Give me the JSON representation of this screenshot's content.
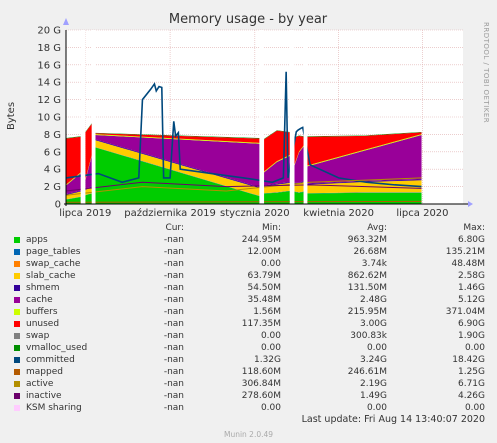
{
  "chart_data": {
    "type": "area",
    "title": "Memory usage - by year",
    "ylabel": "Bytes",
    "side_label": "RRDTOOL / TOBI OETIKER",
    "ylim": [
      0,
      20
    ],
    "y_ticks": [
      "0",
      "2 G",
      "4 G",
      "6 G",
      "8 G",
      "10 G",
      "12 G",
      "14 G",
      "16 G",
      "18 G",
      "20 G"
    ],
    "x_ticks": [
      "lipca 2019",
      "października 2019",
      "stycznia 2020",
      "kwietnia 2020",
      "lipca 2020"
    ],
    "x_range": [
      "2019-06-10",
      "2020-08-14"
    ],
    "gaps": [
      [
        "2019-06-26",
        "2019-07-01"
      ],
      [
        "2019-07-08",
        "2019-07-12"
      ],
      [
        "2020-01-06",
        "2020-01-11"
      ],
      [
        "2020-02-08",
        "2020-02-13"
      ],
      [
        "2020-02-23",
        "2020-02-27"
      ]
    ],
    "series": [
      {
        "name": "apps",
        "color": "#00cc00",
        "values": [
          [
            0.5,
            0.8
          ],
          [
            1.0,
            1.2
          ],
          [
            6.5,
            0.9
          ],
          [
            1.2,
            1.3,
            1.5
          ],
          [
            1.4,
            1.3,
            1.4
          ],
          [
            1.2,
            1.3,
            1.3
          ]
        ]
      },
      {
        "name": "page_tables",
        "color": "#0066b3",
        "values": [
          [
            0.03,
            0.03
          ],
          [
            0.03,
            0.03
          ],
          [
            0.03,
            0.03
          ],
          [
            0.03,
            0.03,
            0.03
          ],
          [
            0.03,
            0.03,
            0.03
          ],
          [
            0.03,
            0.03,
            0.03
          ]
        ]
      },
      {
        "name": "swap_cache",
        "color": "#ff8000",
        "values": [
          [
            0,
            0
          ],
          [
            0,
            0
          ],
          [
            0,
            0
          ],
          [
            0,
            0,
            0
          ],
          [
            0,
            0,
            0
          ],
          [
            0,
            0,
            0
          ]
        ]
      },
      {
        "name": "slab_cache",
        "color": "#ffcc00",
        "values": [
          [
            0.5,
            0.6
          ],
          [
            0.6,
            0.7
          ],
          [
            0.8,
            0.9
          ],
          [
            0.8,
            0.9,
            0.9
          ],
          [
            0.9,
            1.0,
            1.1
          ],
          [
            1.0,
            1.2,
            1.4
          ]
        ]
      },
      {
        "name": "shmem",
        "color": "#330099",
        "values": [
          [
            0.1,
            0.1
          ],
          [
            0.1,
            0.1
          ],
          [
            0.1,
            0.1
          ],
          [
            0.1,
            0.1,
            0.1
          ],
          [
            0.1,
            0.1,
            0.1
          ],
          [
            0.1,
            0.1,
            0.1
          ]
        ]
      },
      {
        "name": "cache",
        "color": "#990099",
        "values": [
          [
            1.0,
            2.0
          ],
          [
            1.0,
            3.5
          ],
          [
            0.5,
            5.0
          ],
          [
            1.5,
            2.5,
            3.0
          ],
          [
            2.0,
            3.5,
            4.0
          ],
          [
            2.0,
            3.5,
            5.1
          ]
        ]
      },
      {
        "name": "buffers",
        "color": "#ccff00",
        "values": [
          [
            0.1,
            0.1
          ],
          [
            0.1,
            0.1
          ],
          [
            0.1,
            0.1
          ],
          [
            0.1,
            0.1,
            0.1
          ],
          [
            0.1,
            0.1,
            0.1
          ],
          [
            0.1,
            0.1,
            0.1
          ]
        ]
      },
      {
        "name": "unused",
        "color": "#ff0000",
        "values": [
          [
            5.3,
            4.1
          ],
          [
            5.4,
            3.6
          ],
          [
            0.1,
            0.5
          ],
          [
            3.7,
            3.5,
            2.6
          ],
          [
            3.1,
            1.8,
            1.0
          ],
          [
            3.3,
            1.6,
            0.2
          ]
        ]
      },
      {
        "name": "swap",
        "color": "#808080",
        "values": [
          [
            0,
            0
          ],
          [
            0,
            0
          ],
          [
            0,
            0
          ],
          [
            0,
            0,
            0
          ],
          [
            0,
            0,
            0
          ],
          [
            0,
            0,
            0
          ]
        ]
      },
      {
        "name": "vmalloc_used",
        "color": "#008f00",
        "values": [
          [
            0.05,
            0.05
          ],
          [
            0.05,
            0.05
          ],
          [
            0.05,
            0.05
          ],
          [
            0.05,
            0.05,
            0.05
          ],
          [
            0.05,
            0.05,
            0.05
          ],
          [
            0.05,
            0.05,
            0.05
          ]
        ]
      },
      {
        "name": "committed",
        "color": "#00487d",
        "line": true,
        "points": [
          [
            "2019-06-10",
            3.0
          ],
          [
            "2019-07-15",
            3.5
          ],
          [
            "2019-08-10",
            2.5
          ],
          [
            "2019-08-28",
            3.0
          ],
          [
            "2019-09-01",
            12.0
          ],
          [
            "2019-09-10",
            13.2
          ],
          [
            "2019-09-14",
            13.8
          ],
          [
            "2019-09-16",
            13.0
          ],
          [
            "2019-09-19",
            13.5
          ],
          [
            "2019-09-22",
            13.4
          ],
          [
            "2019-09-24",
            3.0
          ],
          [
            "2019-10-01",
            3.0
          ],
          [
            "2019-10-05",
            9.5
          ],
          [
            "2019-10-07",
            7.8
          ],
          [
            "2019-10-10",
            8.2
          ],
          [
            "2019-10-12",
            4.0
          ],
          [
            "2019-11-15",
            3.5
          ],
          [
            "2019-12-20",
            3.0
          ],
          [
            "2020-01-20",
            2.5
          ],
          [
            "2020-02-01",
            3.0
          ],
          [
            "2020-02-04",
            15.2
          ],
          [
            "2020-02-06",
            3.0
          ],
          [
            "2020-02-15",
            8.3
          ],
          [
            "2020-02-17",
            8.5
          ],
          [
            "2020-02-20",
            8.7
          ],
          [
            "2020-02-22",
            8.8
          ],
          [
            "2020-03-01",
            4.5
          ],
          [
            "2020-04-01",
            3.0
          ],
          [
            "2020-05-01",
            2.5
          ],
          [
            "2020-06-01",
            2.2
          ],
          [
            "2020-06-30",
            2.0
          ]
        ]
      },
      {
        "name": "mapped",
        "color": "#b35a00",
        "line": true,
        "points": [
          [
            "2019-06-10",
            0.2
          ],
          [
            "2020-06-30",
            0.3
          ]
        ]
      },
      {
        "name": "active",
        "color": "#b38f00",
        "line": true,
        "points": [
          [
            "2019-06-10",
            1.0
          ],
          [
            "2019-09-01",
            2.0
          ],
          [
            "2019-12-01",
            1.5
          ],
          [
            "2020-03-01",
            2.5
          ],
          [
            "2020-06-30",
            3.0
          ]
        ]
      },
      {
        "name": "inactive",
        "color": "#6b006b",
        "line": true,
        "points": [
          [
            "2019-06-10",
            1.5
          ],
          [
            "2019-09-01",
            2.5
          ],
          [
            "2019-12-01",
            2.0
          ],
          [
            "2020-03-01",
            2.2
          ],
          [
            "2020-06-30",
            1.8
          ]
        ]
      },
      {
        "name": "KSM sharing",
        "color": "#ffccff",
        "line": true,
        "points": [
          [
            "2019-06-10",
            0
          ],
          [
            "2020-06-30",
            0
          ]
        ]
      }
    ]
  },
  "legend": {
    "headers": [
      "Cur:",
      "Min:",
      "Avg:",
      "Max:"
    ],
    "rows": [
      {
        "name": "apps",
        "color": "#00cc00",
        "cur": "-nan",
        "min": "244.95M",
        "avg": "963.32M",
        "max": "6.80G"
      },
      {
        "name": "page_tables",
        "color": "#0066b3",
        "cur": "-nan",
        "min": "12.00M",
        "avg": "26.68M",
        "max": "135.21M"
      },
      {
        "name": "swap_cache",
        "color": "#ff8000",
        "cur": "-nan",
        "min": "0.00",
        "avg": "3.74k",
        "max": "48.48M"
      },
      {
        "name": "slab_cache",
        "color": "#ffcc00",
        "cur": "-nan",
        "min": "63.79M",
        "avg": "862.62M",
        "max": "2.58G"
      },
      {
        "name": "shmem",
        "color": "#330099",
        "cur": "-nan",
        "min": "54.50M",
        "avg": "131.50M",
        "max": "1.46G"
      },
      {
        "name": "cache",
        "color": "#990099",
        "cur": "-nan",
        "min": "35.48M",
        "avg": "2.48G",
        "max": "5.12G"
      },
      {
        "name": "buffers",
        "color": "#ccff00",
        "cur": "-nan",
        "min": "1.56M",
        "avg": "215.95M",
        "max": "371.04M"
      },
      {
        "name": "unused",
        "color": "#ff0000",
        "cur": "-nan",
        "min": "117.35M",
        "avg": "3.00G",
        "max": "6.90G"
      },
      {
        "name": "swap",
        "color": "#808080",
        "cur": "-nan",
        "min": "0.00",
        "avg": "300.83k",
        "max": "1.90G"
      },
      {
        "name": "vmalloc_used",
        "color": "#008f00",
        "cur": "-nan",
        "min": "0.00",
        "avg": "0.00",
        "max": "0.00"
      },
      {
        "name": "committed",
        "color": "#00487d",
        "cur": "-nan",
        "min": "1.32G",
        "avg": "3.24G",
        "max": "18.42G"
      },
      {
        "name": "mapped",
        "color": "#b35a00",
        "cur": "-nan",
        "min": "118.60M",
        "avg": "246.61M",
        "max": "1.25G"
      },
      {
        "name": "active",
        "color": "#b38f00",
        "cur": "-nan",
        "min": "306.84M",
        "avg": "2.19G",
        "max": "6.71G"
      },
      {
        "name": "inactive",
        "color": "#6b006b",
        "cur": "-nan",
        "min": "278.60M",
        "avg": "1.49G",
        "max": "4.26G"
      },
      {
        "name": "KSM sharing",
        "color": "#ffccff",
        "cur": "-nan",
        "min": "0.00",
        "avg": "0.00",
        "max": "0.00"
      }
    ]
  },
  "last_update": "Last update: Fri Aug 14 13:40:07 2020",
  "footer": "Munin 2.0.49"
}
